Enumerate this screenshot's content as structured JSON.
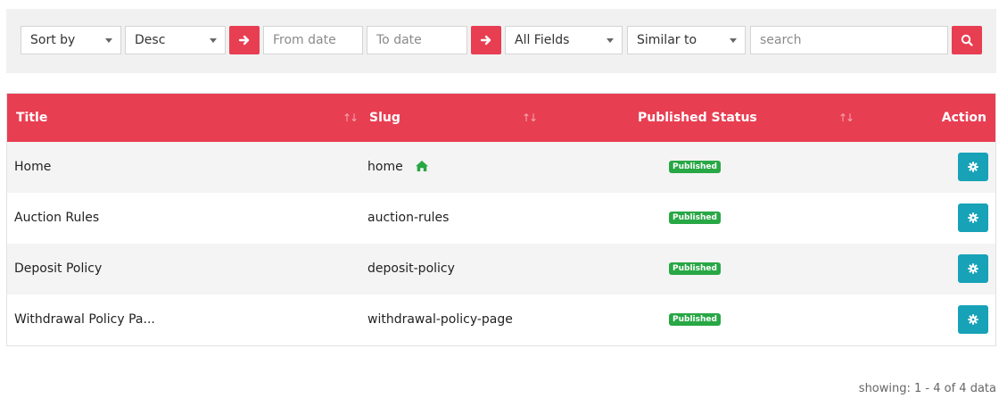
{
  "filters": {
    "sort_by": "Sort by",
    "order": "Desc",
    "from_date_placeholder": "From date",
    "to_date_placeholder": "To date",
    "field": "All Fields",
    "match": "Similar to",
    "search_placeholder": "search"
  },
  "table": {
    "headers": {
      "title": "Title",
      "slug": "Slug",
      "status": "Published Status",
      "action": "Action"
    },
    "rows": [
      {
        "title": "Home",
        "slug": "home",
        "status": "Published",
        "is_home": true
      },
      {
        "title": "Auction Rules",
        "slug": "auction-rules",
        "status": "Published",
        "is_home": false
      },
      {
        "title": "Deposit Policy",
        "slug": "deposit-policy",
        "status": "Published",
        "is_home": false
      },
      {
        "title": "Withdrawal Policy Pa...",
        "slug": "withdrawal-policy-page",
        "status": "Published",
        "is_home": false
      }
    ]
  },
  "footer": {
    "showing": "showing: 1 - 4 of 4 data"
  },
  "colors": {
    "accent": "#e83e52",
    "published_badge": "#28a745",
    "action_button": "#17a2b8",
    "home_icon": "#28a745"
  },
  "icons": {
    "apply": "arrow-right-icon",
    "search": "search-icon",
    "home": "home-icon",
    "action": "gear-icon",
    "sort": "sort-arrows-icon"
  }
}
